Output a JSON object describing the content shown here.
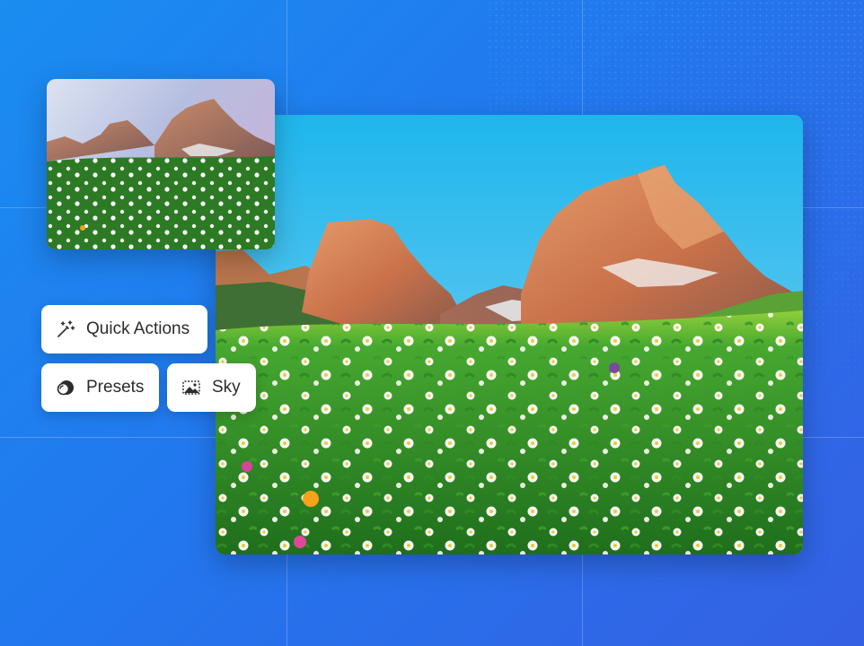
{
  "actions": {
    "quick_actions_label": "Quick Actions",
    "presets_label": "Presets",
    "sky_label": "Sky"
  },
  "icons": {
    "quick_actions": "magic-wand-icon",
    "presets": "presets-icon",
    "sky": "sky-replace-icon"
  },
  "colors": {
    "background_start": "#1a8df0",
    "background_end": "#3560e4",
    "chip_background": "#ffffff",
    "chip_text": "#2c2c2c"
  }
}
